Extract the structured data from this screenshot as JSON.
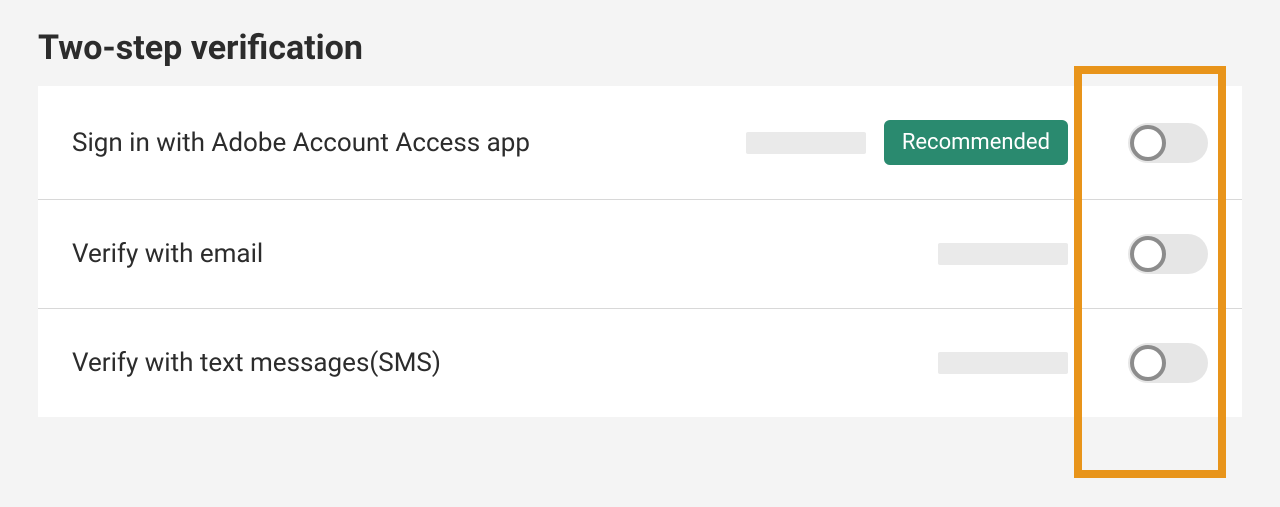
{
  "section": {
    "title": "Two-step verification"
  },
  "rows": [
    {
      "label": "Sign in with Adobe Account Access app",
      "badge": "Recommended",
      "toggle": false
    },
    {
      "label": "Verify with email",
      "toggle": false
    },
    {
      "label": "Verify with text messages(SMS)",
      "toggle": false
    }
  ],
  "colors": {
    "badge_bg": "#2a8a6f",
    "highlight": "#e8941a"
  }
}
